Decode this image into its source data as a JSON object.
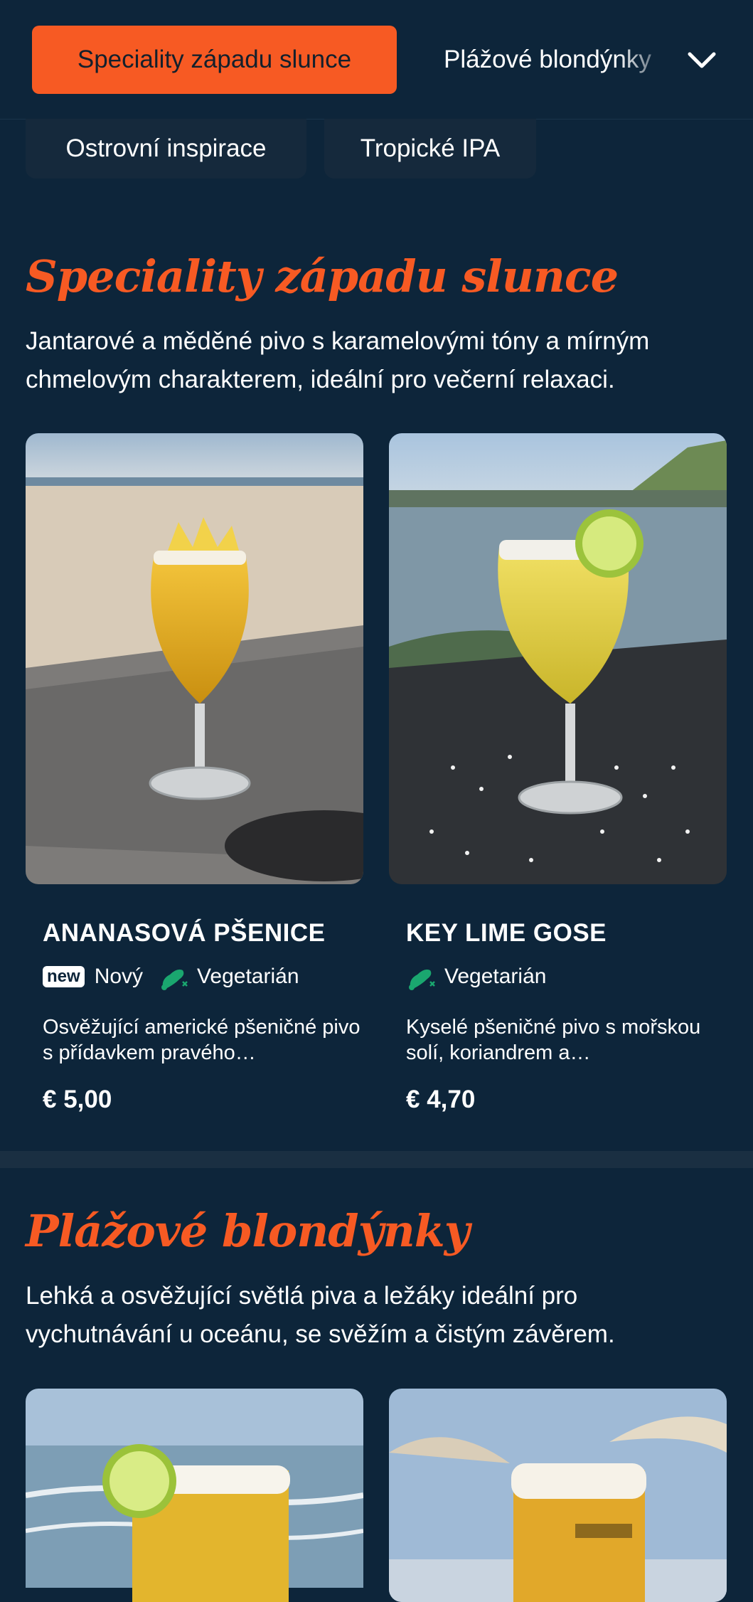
{
  "nav": {
    "active_category": "Speciality západu slunce",
    "next_category": "Plážové blondýnky",
    "chevron_icon": "chevron-down-icon",
    "pills": [
      "Ostrovní inspirace",
      "Tropické IPA"
    ]
  },
  "sections": [
    {
      "title": "Speciality západu slunce",
      "description": "Jantarové a měděné pivo s karamelovými tóny a mírným chmelovým charakterem, ideální pro večerní relaxaci.",
      "items": [
        {
          "name": "ANANASOVÁ PŠENICE",
          "badge": "new",
          "badge_label": "Nový",
          "tag": "Vegetarián",
          "description": "Osvěžující americké pšeničné pivo s přídavkem pravého…",
          "price": "€ 5,00",
          "image": "pineapple-wheat-beer-on-beach-photo"
        },
        {
          "name": "KEY LIME GOSE",
          "tag": "Vegetarián",
          "description": "Kyselé pšeničné pivo s mořskou solí, koriandrem a…",
          "price": "€ 4,70",
          "image": "lime-gose-with-salt-rim-coast-photo"
        }
      ]
    },
    {
      "title": "Plážové blondýnky",
      "description": "Lehká a osvěžující světlá piva a ležáky ideální pro vychutnávání u oceánu, se svěžím a čistým závěrem.",
      "items": [
        {
          "image": "lager-with-lime-ocean-photo"
        },
        {
          "image": "beer-glass-beach-umbrellas-photo"
        }
      ]
    }
  ],
  "colors": {
    "background": "#0d253a",
    "accent": "#f75a23",
    "pill_bg": "#15293c",
    "veg_icon": "#1aa76f"
  },
  "icons": {
    "vegetarian": "vegetarian-leg-icon"
  }
}
